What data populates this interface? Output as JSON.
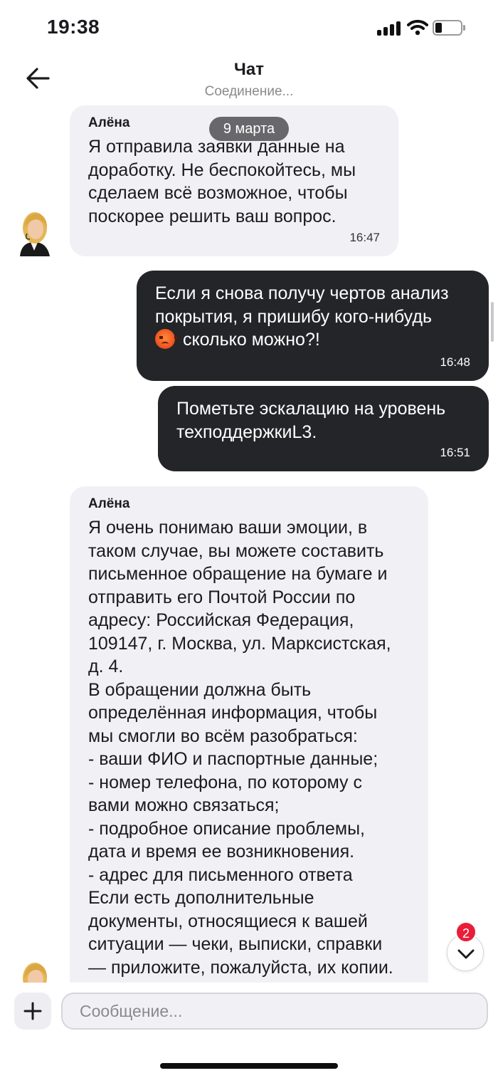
{
  "status_bar": {
    "time": "19:38"
  },
  "header": {
    "title": "Чат",
    "subtitle": "Соединение..."
  },
  "date_chip": "9 марта",
  "messages": [
    {
      "sender": "Алёна",
      "text": "Я отправила заявки данные на\nдоработку. Не беспокойтесь, мы\nсделаем всё возможное, чтобы\nпоскорее решить ваш вопрос.",
      "time": "16:47"
    },
    {
      "text_before_emoji": "Если я снова получу чертов анализ\nпокрытия, я пришибу кого-нибудь\n",
      "emoji": "angry-face-emoji",
      "text_after_emoji": " сколько можно?!",
      "time": "16:48"
    },
    {
      "text": "Пометьте эскалацию на уровень\nтехподдержкиL3.",
      "time": "16:51"
    },
    {
      "sender": "Алёна",
      "text": "Я очень понимаю ваши эмоции, в\nтаком случае, вы можете составить\nписьменное обращение на бумаге и\nотправить его Почтой России по\nадресу: Российская Федерация,\n109147, г. Москва, ул. Марксистская,\nд. 4.\nВ обращении должна быть\nопределённая информация, чтобы\nмы смогли во всём разобраться:\n- ваши ФИО и паспортные данные;\n- номер телефона, по которому с\nвами можно связаться;\n- подробное описание проблемы,\nдата и время ее возникновения.\n- адрес для письменного ответа\nЕсли есть дополнительные\nдокументы, относящиеся к вашей\nситуации — чеки, выписки, справки\n— приложите, пожалуйста, их копии."
    }
  ],
  "unread_count": "2",
  "input": {
    "placeholder": "Сообщение..."
  },
  "colors": {
    "outgoing_bubble": "#232528",
    "incoming_bubble": "#f1f1f5",
    "badge": "#ea1d39"
  }
}
